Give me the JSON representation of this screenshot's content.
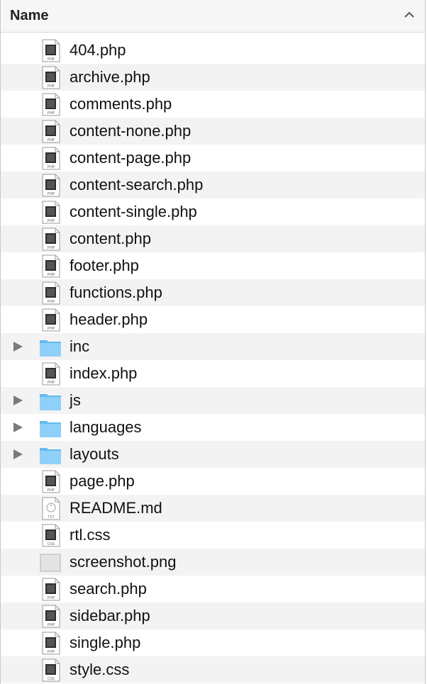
{
  "header": {
    "title": "Name",
    "sort_icon": "chevron-up-icon"
  },
  "files": [
    {
      "name": "404.php",
      "kind": "php",
      "badge": "PHP"
    },
    {
      "name": "archive.php",
      "kind": "php",
      "badge": "PHP"
    },
    {
      "name": "comments.php",
      "kind": "php",
      "badge": "PHP"
    },
    {
      "name": "content-none.php",
      "kind": "php",
      "badge": "PHP"
    },
    {
      "name": "content-page.php",
      "kind": "php",
      "badge": "PHP"
    },
    {
      "name": "content-search.php",
      "kind": "php",
      "badge": "PHP"
    },
    {
      "name": "content-single.php",
      "kind": "php",
      "badge": "PHP"
    },
    {
      "name": "content.php",
      "kind": "php",
      "badge": "PHP"
    },
    {
      "name": "footer.php",
      "kind": "php",
      "badge": "PHP"
    },
    {
      "name": "functions.php",
      "kind": "php",
      "badge": "PHP"
    },
    {
      "name": "header.php",
      "kind": "php",
      "badge": "PHP"
    },
    {
      "name": "inc",
      "kind": "folder"
    },
    {
      "name": "index.php",
      "kind": "php",
      "badge": "PHP"
    },
    {
      "name": "js",
      "kind": "folder"
    },
    {
      "name": "languages",
      "kind": "folder"
    },
    {
      "name": "layouts",
      "kind": "folder"
    },
    {
      "name": "page.php",
      "kind": "php",
      "badge": "PHP"
    },
    {
      "name": "README.md",
      "kind": "md",
      "badge": "TXT"
    },
    {
      "name": "rtl.css",
      "kind": "css",
      "badge": "CSS"
    },
    {
      "name": "screenshot.png",
      "kind": "png"
    },
    {
      "name": "search.php",
      "kind": "php",
      "badge": "PHP"
    },
    {
      "name": "sidebar.php",
      "kind": "php",
      "badge": "PHP"
    },
    {
      "name": "single.php",
      "kind": "php",
      "badge": "PHP"
    },
    {
      "name": "style.css",
      "kind": "css",
      "badge": "CSS"
    }
  ]
}
